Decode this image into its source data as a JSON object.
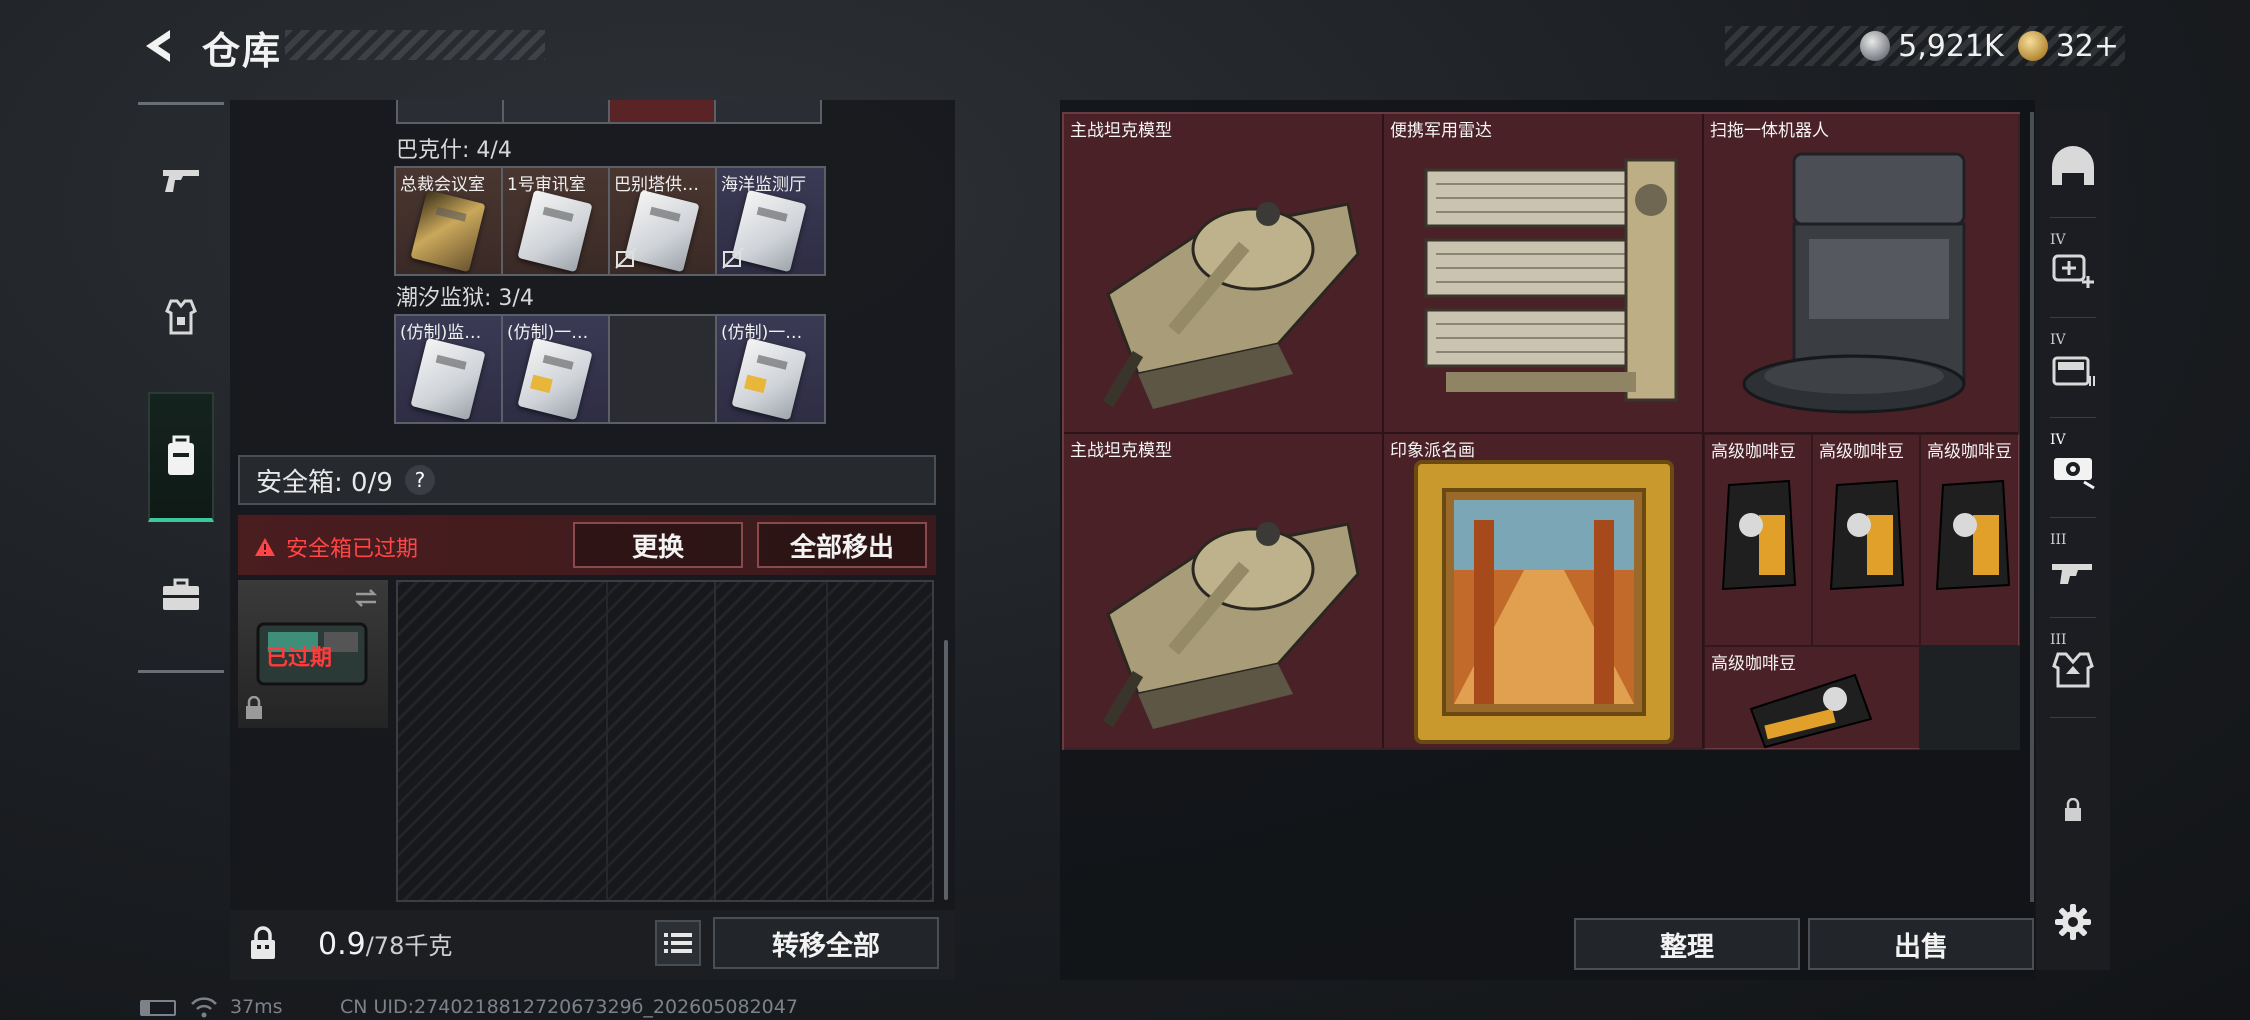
{
  "header": {
    "title": "仓库"
  },
  "currency": {
    "silver": "5,921K",
    "gold": "32+"
  },
  "left_panel": {
    "sections": [
      {
        "label": "巴克什: 4/4",
        "slots": [
          {
            "name": "总裁会议室",
            "style": "brown"
          },
          {
            "name": "1号审讯室",
            "style": "brown"
          },
          {
            "name": "巴别塔供…",
            "style": "brown"
          },
          {
            "name": "海洋监测厅",
            "style": "purple"
          }
        ]
      },
      {
        "label": "潮汐监狱: 3/4",
        "slots": [
          {
            "name": "(仿制)监…",
            "style": "purple"
          },
          {
            "name": "(仿制)一…",
            "style": "purple"
          },
          {
            "name": "",
            "style": "empty"
          },
          {
            "name": "(仿制)一…",
            "style": "purple"
          }
        ]
      }
    ],
    "safe_box": {
      "title": "安全箱: 0/9",
      "help": "?",
      "expired_notice": "安全箱已过期",
      "replace_button": "更换",
      "remove_all_button": "全部移出",
      "thumb_label": "已过期"
    },
    "weight": {
      "current": "0.9",
      "capacity": "/78千克"
    },
    "transfer_all_button": "转移全部"
  },
  "storage": {
    "items": [
      {
        "name": "主战坦克模型"
      },
      {
        "name": "便携军用雷达"
      },
      {
        "name": "扫拖一体机器人"
      },
      {
        "name": "主战坦克模型"
      },
      {
        "name": "印象派名画"
      },
      {
        "name": "高级咖啡豆"
      },
      {
        "name": "高级咖啡豆"
      },
      {
        "name": "高级咖啡豆"
      },
      {
        "name": "高级咖啡豆"
      }
    ],
    "sort_button": "整理",
    "sell_button": "出售"
  },
  "right_rail": {
    "tabs": [
      {
        "icon": "helmet-icon",
        "roman": ""
      },
      {
        "icon": "armor-plus-icon",
        "roman": "IV"
      },
      {
        "icon": "backpack-icon",
        "roman": "IV"
      },
      {
        "icon": "chest-rig-icon",
        "roman": "IV"
      },
      {
        "icon": "rifle-icon",
        "roman": "III"
      },
      {
        "icon": "vest-icon",
        "roman": "III"
      }
    ]
  },
  "status_bar": {
    "ping": "37ms",
    "uid": "CN UID:274021881272067329б_202605082047"
  },
  "colors": {
    "accent_green": "#3ec79a",
    "danger_red": "#ff4545",
    "storage_bg": "#4b2128"
  }
}
